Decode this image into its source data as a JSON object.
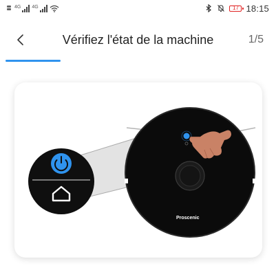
{
  "status_bar": {
    "time": "18:15",
    "battery_level": "17",
    "network_tags": [
      "4G",
      "4G"
    ],
    "icons": [
      "sim-icon",
      "signal-icon",
      "wifi-icon",
      "bluetooth-icon",
      "mute-icon",
      "battery-icon"
    ]
  },
  "header": {
    "back_icon": "chevron-left-icon",
    "title": "Vérifiez l'état de la machine",
    "step": "1/5",
    "progress": 0.2
  },
  "illustration": {
    "brand": "Proscenic",
    "icons": [
      "power-icon",
      "home-icon",
      "hand-pointer-icon"
    ]
  },
  "colors": {
    "accent": "#2f93ee",
    "robot": "#0b0b0b",
    "hand": "#c98266"
  }
}
